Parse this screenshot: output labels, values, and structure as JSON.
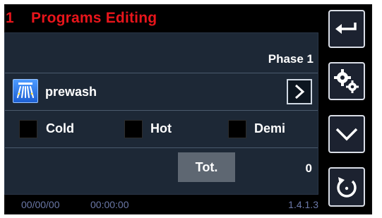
{
  "header": {
    "number": "1",
    "title": "Programs Editing"
  },
  "phase": {
    "label": "Phase 1"
  },
  "program": {
    "icon": "prewash-icon",
    "label": "prewash",
    "next_icon": "chevron-right-icon"
  },
  "water_options": [
    {
      "label": "Cold",
      "checked": false
    },
    {
      "label": "Hot",
      "checked": false
    },
    {
      "label": "Demi",
      "checked": false
    }
  ],
  "totals": {
    "button_label": "Tot.",
    "value": "0"
  },
  "status": {
    "date": "00/00/00",
    "time": "00:00:00",
    "version": "1.4.1.3"
  },
  "side_buttons": [
    {
      "icon": "back-arrow-icon"
    },
    {
      "icon": "gears-icon"
    },
    {
      "icon": "chevron-down-icon"
    },
    {
      "icon": "refresh-icon"
    }
  ],
  "colors": {
    "title": "#e8151b",
    "panel": "#1d2836",
    "status_text": "#6b78a8",
    "prewash_icon": "#2f7de8"
  }
}
